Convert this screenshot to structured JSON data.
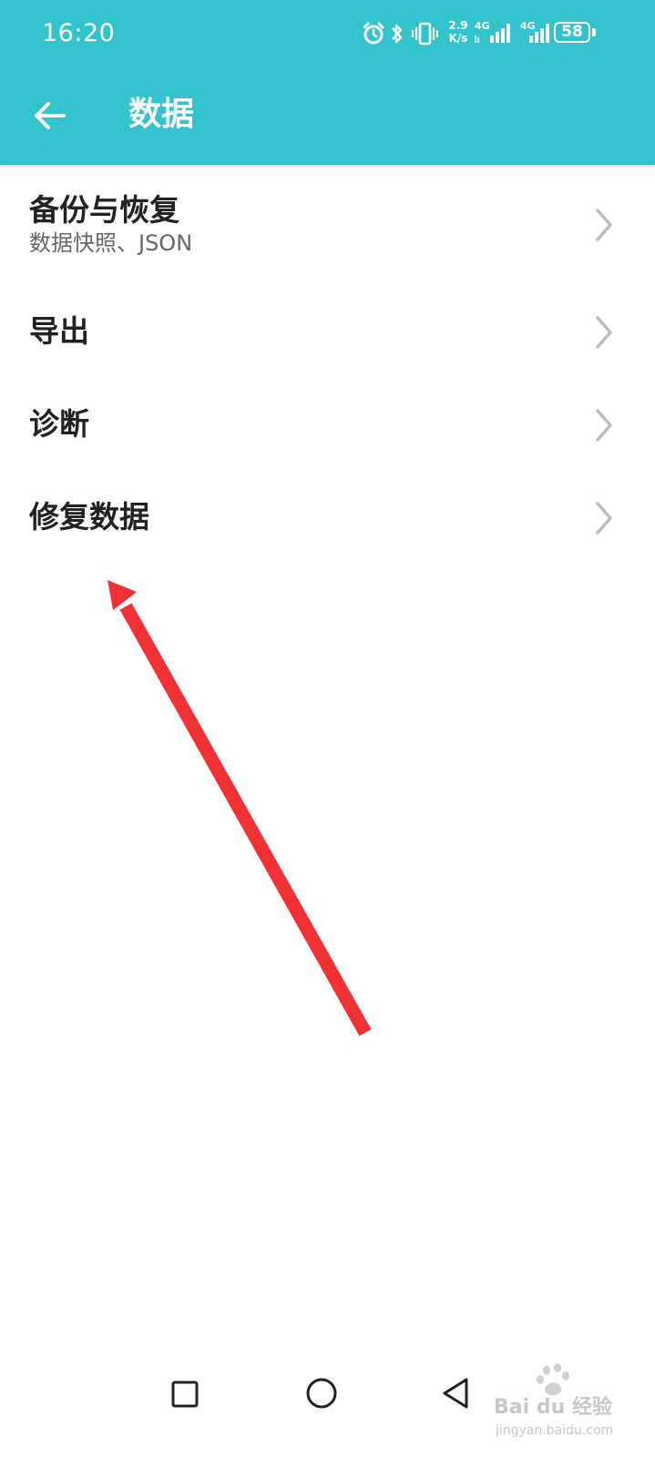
{
  "status_bar": {
    "time": "16:20",
    "net_speed_value": "2.9",
    "net_speed_unit": "K/s",
    "signal_1_label": "4G",
    "signal_2_label": "4G",
    "battery_level": "58",
    "icons": [
      "alarm-icon",
      "bluetooth-icon",
      "vibrate-icon",
      "signal-icon",
      "signal-icon",
      "battery-icon"
    ]
  },
  "app_bar": {
    "back_icon": "arrow-left-icon",
    "title": "数据"
  },
  "menu": {
    "items": [
      {
        "title": "备份与恢复",
        "subtitle": "数据快照、JSON"
      },
      {
        "title": "导出"
      },
      {
        "title": "诊断"
      },
      {
        "title": "修复数据"
      }
    ]
  },
  "nav_bar": {
    "icons": [
      "recents-square-icon",
      "home-circle-icon",
      "back-triangle-icon"
    ]
  },
  "watermark": {
    "logo_text": "Bai du 经验",
    "url": "jingyan.baidu.com"
  },
  "colors": {
    "header_bg": "#33c3cc",
    "title_text": "#222222",
    "subtitle_text": "#666666",
    "chevron": "#bdbdbd",
    "annotation_arrow": "#f03237"
  }
}
